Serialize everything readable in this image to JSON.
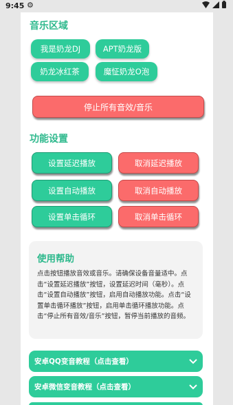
{
  "status_bar": {
    "time": "9:45",
    "settings_icon": "gear-icon",
    "wifi_icon": "wifi-icon",
    "signal_icon": "signal-icon",
    "battery_icon": "battery-icon"
  },
  "music": {
    "title": "音乐区域",
    "items": [
      "我是奶龙DJ",
      "APT奶龙版",
      "奶龙冰红茶",
      "魔怔奶龙O泡"
    ],
    "stop_all": "停止所有音效/音乐"
  },
  "functions": {
    "title": "功能设置",
    "set_delay": "设置延迟播放",
    "cancel_delay": "取消延迟播放",
    "set_auto": "设置自动播放",
    "cancel_auto": "取消自动播放",
    "set_loop": "设置单击循环",
    "cancel_loop": "取消单击循环"
  },
  "help": {
    "title": "使用帮助",
    "text": "点击按钮播放音效或音乐。请确保设备音量适中。点击“设置延迟播放”按钮，设置延迟时间（毫秒）。点击“设置自动播放”按钮，启用自动播放功能。点击“设置单击循环播放”按钮，启用单击循环播放功能。点击“停止所有音效/音乐”按钮，暂停当前播放的音频。"
  },
  "accordions": [
    {
      "label": "安卓QQ变音教程（点击查看）",
      "icon": "chevron-down-icon"
    },
    {
      "label": "安卓微信变音教程（点击查看）",
      "icon": "chevron-down-icon"
    }
  ],
  "colors": {
    "accent": "#2ecc9a",
    "danger": "#fb6b6b",
    "title": "#2fb98d"
  }
}
